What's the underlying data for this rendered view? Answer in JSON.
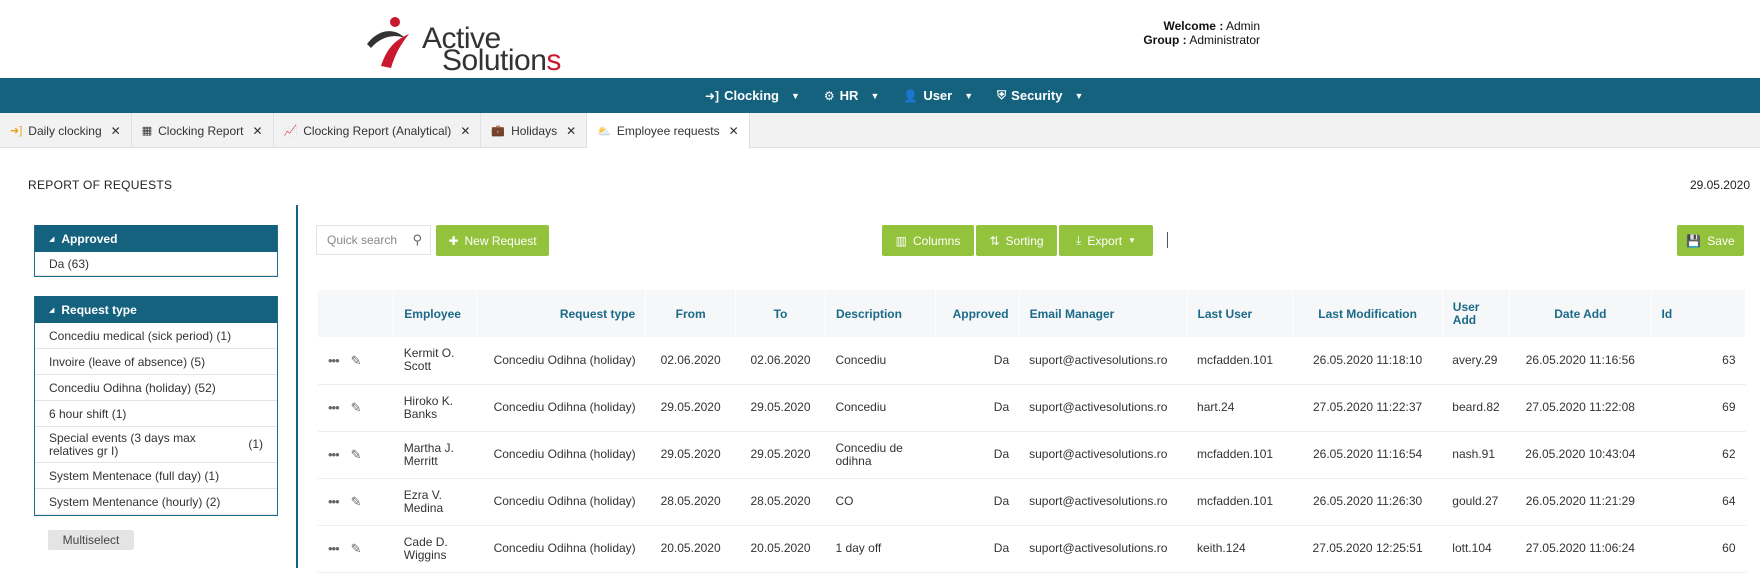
{
  "header": {
    "logo_word1": "Active",
    "logo_word2_main": "Solution",
    "logo_word2_end": "s",
    "welcome_label": "Welcome :",
    "welcome_value": "Admin",
    "group_label": "Group :",
    "group_value": "Administrator"
  },
  "menu": [
    {
      "label": "Clocking",
      "icon": "sign-in-icon"
    },
    {
      "label": "HR",
      "icon": "gear-icon"
    },
    {
      "label": "User",
      "icon": "user-icon"
    },
    {
      "label": "Security",
      "icon": "shield-icon"
    }
  ],
  "tabs": [
    {
      "label": "Daily clocking",
      "icon": "sign-in-icon"
    },
    {
      "label": "Clocking Report",
      "icon": "calendar-icon"
    },
    {
      "label": "Clocking Report (Analytical)",
      "icon": "line-chart-icon"
    },
    {
      "label": "Holidays",
      "icon": "suitcase-icon"
    },
    {
      "label": "Employee requests",
      "icon": "weather-icon"
    }
  ],
  "page": {
    "title": "REPORT OF REQUESTS",
    "date": "29.05.2020"
  },
  "filters": {
    "approved": {
      "title": "Approved",
      "items": [
        {
          "label": "Da (63)",
          "count": ""
        }
      ]
    },
    "request_type": {
      "title": "Request type",
      "items": [
        {
          "label": "Concediu medical (sick period)",
          "count": "(1)"
        },
        {
          "label": "Invoire (leave of absence)",
          "count": "(5)"
        },
        {
          "label": "Concediu Odihna (holiday)",
          "count": "(52)"
        },
        {
          "label": "6 hour shift",
          "count": "(1)"
        },
        {
          "label": "Special events (3 days max relatives gr I)",
          "count": "(1)"
        },
        {
          "label": "System Mentenace (full day)",
          "count": "(1)"
        },
        {
          "label": "System Mentenance (hourly)",
          "count": "(2)"
        }
      ]
    },
    "multiselect_label": "Multiselect"
  },
  "toolbar": {
    "search_placeholder": "Quick search",
    "new_request": "New Request",
    "columns": "Columns",
    "sorting": "Sorting",
    "export": "Export",
    "save": "Save"
  },
  "table": {
    "headers": {
      "employee": "Employee",
      "request_type": "Request type",
      "from": "From",
      "to": "To",
      "description": "Description",
      "approved": "Approved",
      "email_manager": "Email Manager",
      "last_user": "Last User",
      "last_modification": "Last Modification",
      "user_add": "User Add",
      "date_add": "Date Add",
      "id": "Id"
    },
    "rows": [
      {
        "employee": "Kermit O. Scott",
        "request_type": "Concediu Odihna (holiday)",
        "from": "02.06.2020",
        "to": "02.06.2020",
        "description": "Concediu",
        "approved": "Da",
        "email_manager": "suport@activesolutions.ro",
        "last_user": "mcfadden.101",
        "last_modification": "26.05.2020 11:18:10",
        "user_add": "avery.29",
        "date_add": "26.05.2020 11:16:56",
        "id": "63"
      },
      {
        "employee": "Hiroko K. Banks",
        "request_type": "Concediu Odihna (holiday)",
        "from": "29.05.2020",
        "to": "29.05.2020",
        "description": "Concediu",
        "approved": "Da",
        "email_manager": "suport@activesolutions.ro",
        "last_user": "hart.24",
        "last_modification": "27.05.2020 11:22:37",
        "user_add": "beard.82",
        "date_add": "27.05.2020 11:22:08",
        "id": "69"
      },
      {
        "employee": "Martha J. Merritt",
        "request_type": "Concediu Odihna (holiday)",
        "from": "29.05.2020",
        "to": "29.05.2020",
        "description": "Concediu de odihna",
        "approved": "Da",
        "email_manager": "suport@activesolutions.ro",
        "last_user": "mcfadden.101",
        "last_modification": "26.05.2020 11:16:54",
        "user_add": "nash.91",
        "date_add": "26.05.2020 10:43:04",
        "id": "62"
      },
      {
        "employee": "Ezra V. Medina",
        "request_type": "Concediu Odihna (holiday)",
        "from": "28.05.2020",
        "to": "28.05.2020",
        "description": "CO",
        "approved": "Da",
        "email_manager": "suport@activesolutions.ro",
        "last_user": "mcfadden.101",
        "last_modification": "26.05.2020 11:26:30",
        "user_add": "gould.27",
        "date_add": "26.05.2020 11:21:29",
        "id": "64"
      },
      {
        "employee": "Cade D. Wiggins",
        "request_type": "Concediu Odihna (holiday)",
        "from": "20.05.2020",
        "to": "20.05.2020",
        "description": "1 day off",
        "approved": "Da",
        "email_manager": "suport@activesolutions.ro",
        "last_user": "keith.124",
        "last_modification": "27.05.2020 12:25:51",
        "user_add": "lott.104",
        "date_add": "27.05.2020 11:06:24",
        "id": "60"
      }
    ]
  },
  "colors": {
    "primary": "#15627f",
    "accent_green": "#93c33c",
    "brand_red": "#c8192e"
  }
}
